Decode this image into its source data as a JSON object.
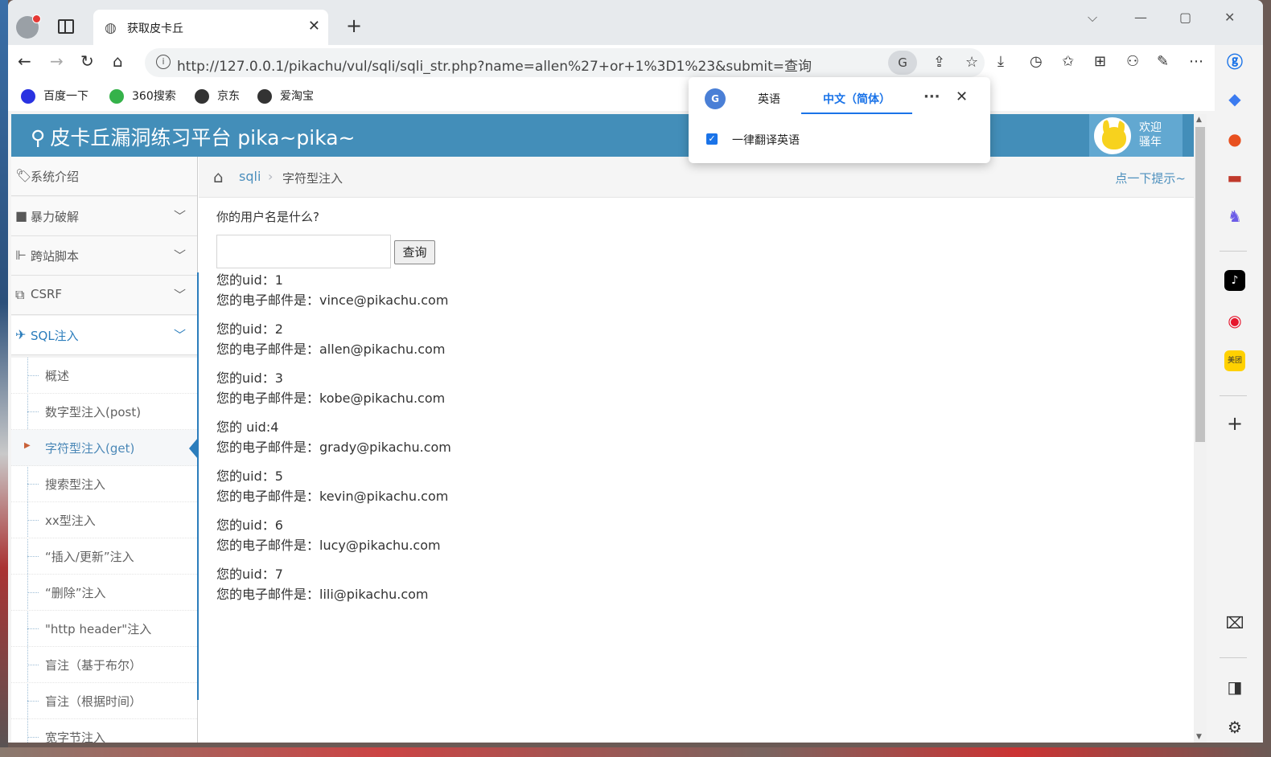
{
  "browser": {
    "tab_title": "获取皮卡丘",
    "url": "http://127.0.0.1/pikachu/vul/sqli/sqli_str.php?name=allen%27+or+1%3D1%23&submit=查询",
    "bookmarks": [
      "百度一下",
      "360搜索",
      "京东",
      "爱淘宝"
    ]
  },
  "translate_popup": {
    "tab_source": "英语",
    "tab_target": "中文（简体）",
    "always_translate": "一律翻译英语"
  },
  "site": {
    "title": "皮卡丘漏洞练习平台 pika~pika~",
    "welcome": "欢迎骚年"
  },
  "sidebar": {
    "menu": [
      {
        "label": "系统介绍",
        "icon": "tag-icon"
      },
      {
        "label": "暴力破解",
        "icon": "lock-icon"
      },
      {
        "label": "跨站脚本",
        "icon": "xss-icon"
      },
      {
        "label": "CSRF",
        "icon": "share-icon"
      },
      {
        "label": "SQL注入",
        "icon": "plane-icon"
      }
    ],
    "sub_items": [
      "概述",
      "数字型注入(post)",
      "字符型注入(get)",
      "搜索型注入",
      "xx型注入",
      "“插入/更新”注入",
      "“删除”注入",
      "\"http header\"注入",
      "盲注（基于布尔）",
      "盲注（根据时间）",
      "宽字节注入"
    ]
  },
  "breadcrumb": {
    "parent": "sqli",
    "current": "字符型注入",
    "hint": "点一下提示~"
  },
  "form": {
    "question": "你的用户名是什么?",
    "input_value": "",
    "submit_label": "查询"
  },
  "results": [
    {
      "uid": "您的uid：1",
      "email": "您的电子邮件是：vince@pikachu.com"
    },
    {
      "uid": "您的uid：2",
      "email": "您的电子邮件是：allen@pikachu.com"
    },
    {
      "uid": "您的uid：3",
      "email": "您的电子邮件是：kobe@pikachu.com"
    },
    {
      "uid": "您的 uid:4",
      "email": "您的电子邮件是：grady@pikachu.com"
    },
    {
      "uid": "您的uid：5",
      "email": "您的电子邮件是：kevin@pikachu.com"
    },
    {
      "uid": "您的uid：6",
      "email": "您的电子邮件是：lucy@pikachu.com"
    },
    {
      "uid": "您的uid：7",
      "email": "您的电子邮件是：lili@pikachu.com"
    }
  ],
  "colors": {
    "header_blue": "#438eb9",
    "accent_blue": "#2b7dbc",
    "link_blue": "#4c8fbd"
  }
}
